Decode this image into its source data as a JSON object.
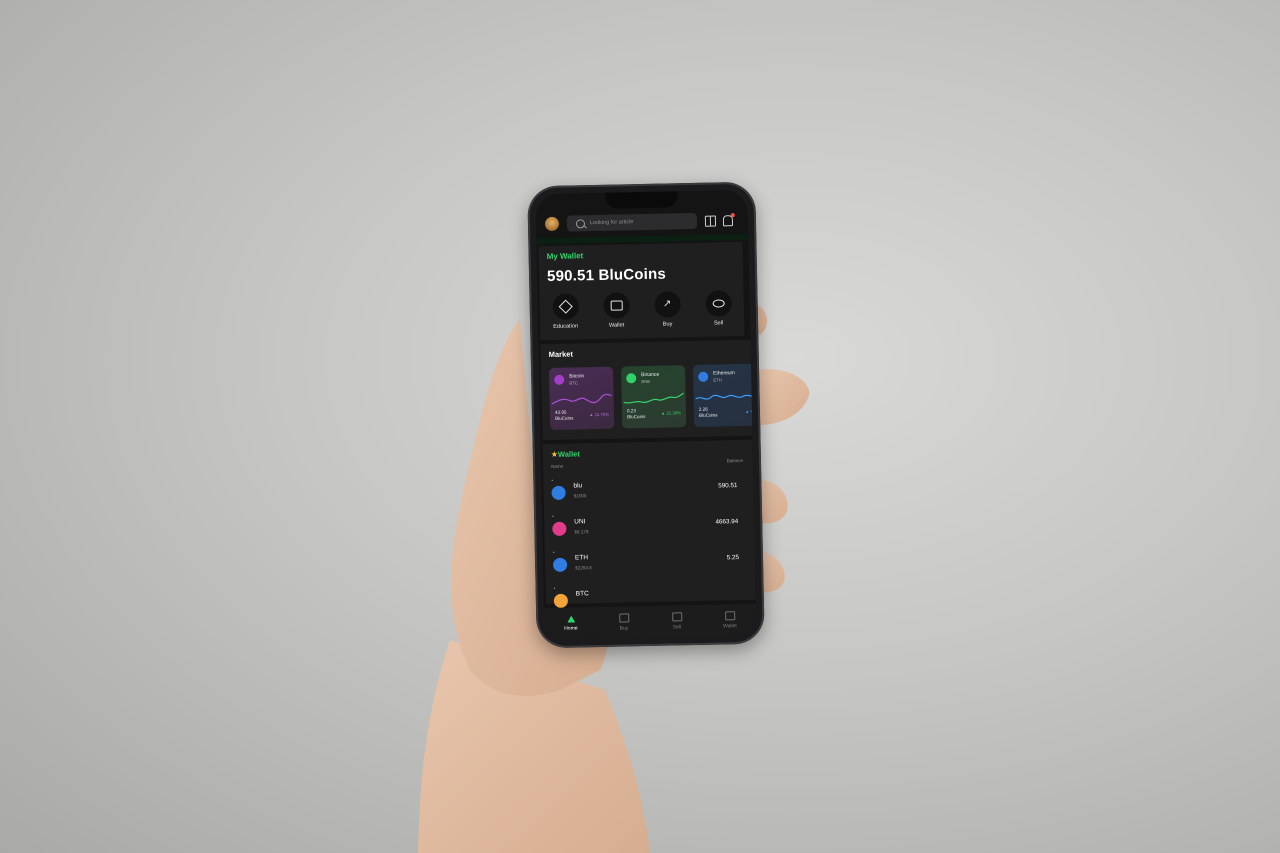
{
  "app": {
    "search": {
      "placeholder": "Looking for article"
    },
    "wallet_card": {
      "title": "My Wallet",
      "balance": "590.51 BluCoins",
      "actions": [
        {
          "label": "Education",
          "icon": "education-icon"
        },
        {
          "label": "Wallet",
          "icon": "wallet-icon"
        },
        {
          "label": "Buy",
          "icon": "chart-up-icon"
        },
        {
          "label": "Sell",
          "icon": "coins-icon"
        }
      ]
    },
    "market": {
      "title": "Market",
      "cards": [
        {
          "name": "Bitcoin",
          "symbol": "BTC",
          "amount_line1": "43.95",
          "amount_line2": "BluCoins",
          "change": "▲ 11.75%",
          "color": "#a23ec9"
        },
        {
          "name": "Binance",
          "symbol": "BNB",
          "amount_line1": "0.23",
          "amount_line2": "BluCoins",
          "change": "▲ 21.39%",
          "color": "#2fd36a"
        },
        {
          "name": "Ethereum",
          "symbol": "ETH",
          "amount_line1": "2.26",
          "amount_line2": "BluCoins",
          "change": "▲ 4",
          "color": "#2f7de0"
        }
      ]
    },
    "wallet_list": {
      "title": "Wallet",
      "col_name": "Name",
      "col_balance": "Balance",
      "rows": [
        {
          "symbol": "blu",
          "usd": "$1000",
          "balance": "590.51",
          "color": "#2f7de0"
        },
        {
          "symbol": "UNI",
          "usd": "$6.178",
          "balance": "4663.94",
          "color": "#e23b8c"
        },
        {
          "symbol": "ETH",
          "usd": "$2264.6",
          "balance": "5.25",
          "color": "#2f7de0"
        },
        {
          "symbol": "BTC",
          "usd": "",
          "balance": "",
          "color": "#f2a33a"
        }
      ]
    },
    "nav": [
      {
        "label": "Home",
        "active": true
      },
      {
        "label": "Buy",
        "active": false
      },
      {
        "label": "Sell",
        "active": false
      },
      {
        "label": "Wallet",
        "active": false
      }
    ]
  }
}
